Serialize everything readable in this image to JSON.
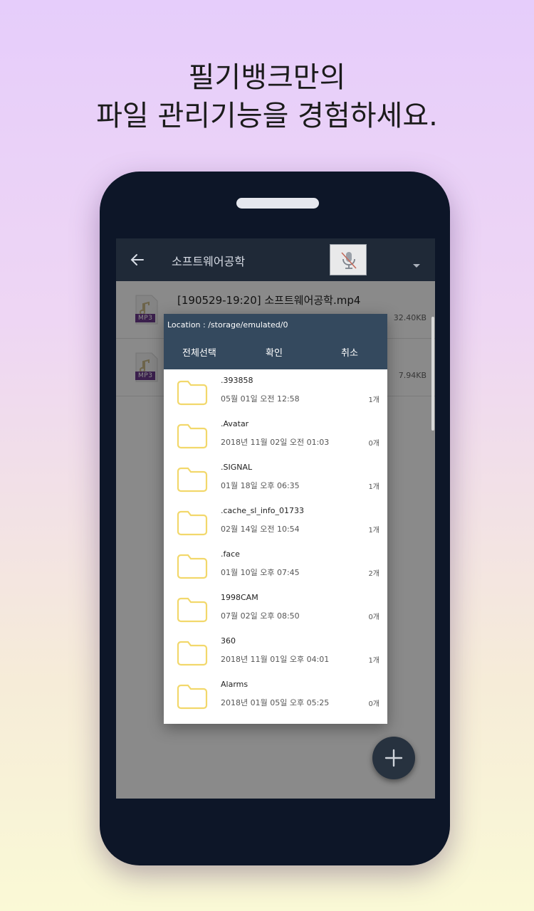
{
  "headline": {
    "line1": "필기뱅크만의",
    "line2": "파일 관리기능을 경험하세요."
  },
  "appbar": {
    "back_icon": "arrow-left-icon",
    "title": "소프트웨어공학",
    "mic_icon": "microphone-off-icon",
    "dropdown_icon": "caret-down-icon"
  },
  "files": [
    {
      "name": "[190529-19:20] 소프트웨어공학.mp4",
      "tag": "MP3",
      "size": "32.40KB"
    },
    {
      "name": "",
      "tag": "MP3",
      "size": "7.94KB"
    }
  ],
  "dialog": {
    "location": "Location : /storage/emulated/0",
    "select_all_label": "전체선택",
    "confirm_label": "확인",
    "cancel_label": "취소",
    "folders": [
      {
        "name": ".393858",
        "date": "05월 01일 오전 12:58",
        "count": "1개"
      },
      {
        "name": ".Avatar",
        "date": "2018년 11월 02일 오전 01:03",
        "count": "0개"
      },
      {
        "name": ".SIGNAL",
        "date": "01월 18일 오후 06:35",
        "count": "1개"
      },
      {
        "name": ".cache_sl_info_01733",
        "date": "02월 14일 오전 10:54",
        "count": "1개"
      },
      {
        "name": ".face",
        "date": "01월 10일 오후 07:45",
        "count": "2개"
      },
      {
        "name": "1998CAM",
        "date": "07월 02일 오후 08:50",
        "count": "0개"
      },
      {
        "name": "360",
        "date": "2018년 11월 01일 오후 04:01",
        "count": "1개"
      },
      {
        "name": "Alarms",
        "date": "2018년 01월 05일 오후 05:25",
        "count": "0개"
      }
    ]
  },
  "fab": {
    "icon": "plus-icon"
  },
  "colors": {
    "appbar": "#1f2937",
    "dialog_header": "#34495e",
    "folder_outline": "#f2d86b",
    "fab": "#27323f"
  }
}
